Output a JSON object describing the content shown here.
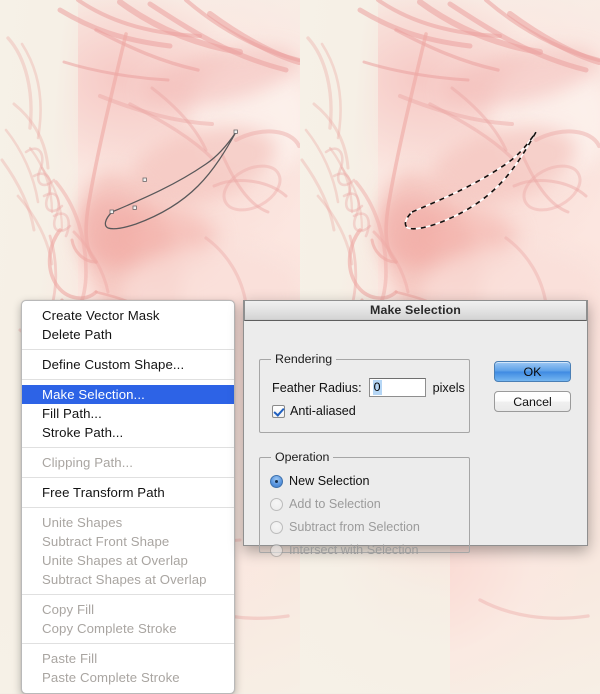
{
  "artwork": {
    "description": "digital painting of a face in pink and peach tones, left panel shows a vector path outline around the eye, right panel shows the same area converted to a marching-ants selection",
    "left_panel_name": "path-view",
    "right_panel_name": "selection-view"
  },
  "context_menu": {
    "name": "paths-context-menu",
    "groups": [
      {
        "items": [
          {
            "label": "Create Vector Mask",
            "state": "enabled"
          },
          {
            "label": "Delete Path",
            "state": "enabled"
          }
        ]
      },
      {
        "items": [
          {
            "label": "Define Custom Shape...",
            "state": "enabled"
          }
        ]
      },
      {
        "items": [
          {
            "label": "Make Selection...",
            "state": "selected"
          },
          {
            "label": "Fill Path...",
            "state": "enabled"
          },
          {
            "label": "Stroke Path...",
            "state": "enabled"
          }
        ]
      },
      {
        "items": [
          {
            "label": "Clipping Path...",
            "state": "disabled"
          }
        ]
      },
      {
        "items": [
          {
            "label": "Free Transform Path",
            "state": "enabled"
          }
        ]
      },
      {
        "items": [
          {
            "label": "Unite Shapes",
            "state": "disabled"
          },
          {
            "label": "Subtract Front Shape",
            "state": "disabled"
          },
          {
            "label": "Unite Shapes at Overlap",
            "state": "disabled"
          },
          {
            "label": "Subtract Shapes at Overlap",
            "state": "disabled"
          }
        ]
      },
      {
        "items": [
          {
            "label": "Copy Fill",
            "state": "disabled"
          },
          {
            "label": "Copy Complete Stroke",
            "state": "disabled"
          }
        ]
      },
      {
        "items": [
          {
            "label": "Paste Fill",
            "state": "disabled"
          },
          {
            "label": "Paste Complete Stroke",
            "state": "disabled"
          }
        ]
      }
    ]
  },
  "dialog": {
    "title": "Make Selection",
    "rendering": {
      "legend": "Rendering",
      "feather_label": "Feather Radius:",
      "feather_value": "0",
      "feather_unit": "pixels",
      "antialiased_label": "Anti-aliased",
      "antialiased_checked": true
    },
    "operation": {
      "legend": "Operation",
      "options": [
        {
          "label": "New Selection",
          "selected": true,
          "enabled": true
        },
        {
          "label": "Add to Selection",
          "selected": false,
          "enabled": false
        },
        {
          "label": "Subtract from Selection",
          "selected": false,
          "enabled": false
        },
        {
          "label": "Intersect with Selection",
          "selected": false,
          "enabled": false
        }
      ]
    },
    "buttons": {
      "ok": "OK",
      "cancel": "Cancel"
    }
  },
  "colors": {
    "menu_highlight": "#2d63e6",
    "default_button": "#5ba0e8",
    "field_selection": "#b5d6f5",
    "dialog_face": "#ececec",
    "skin_base": "#fae2da",
    "paper": "#f6f1e7"
  }
}
